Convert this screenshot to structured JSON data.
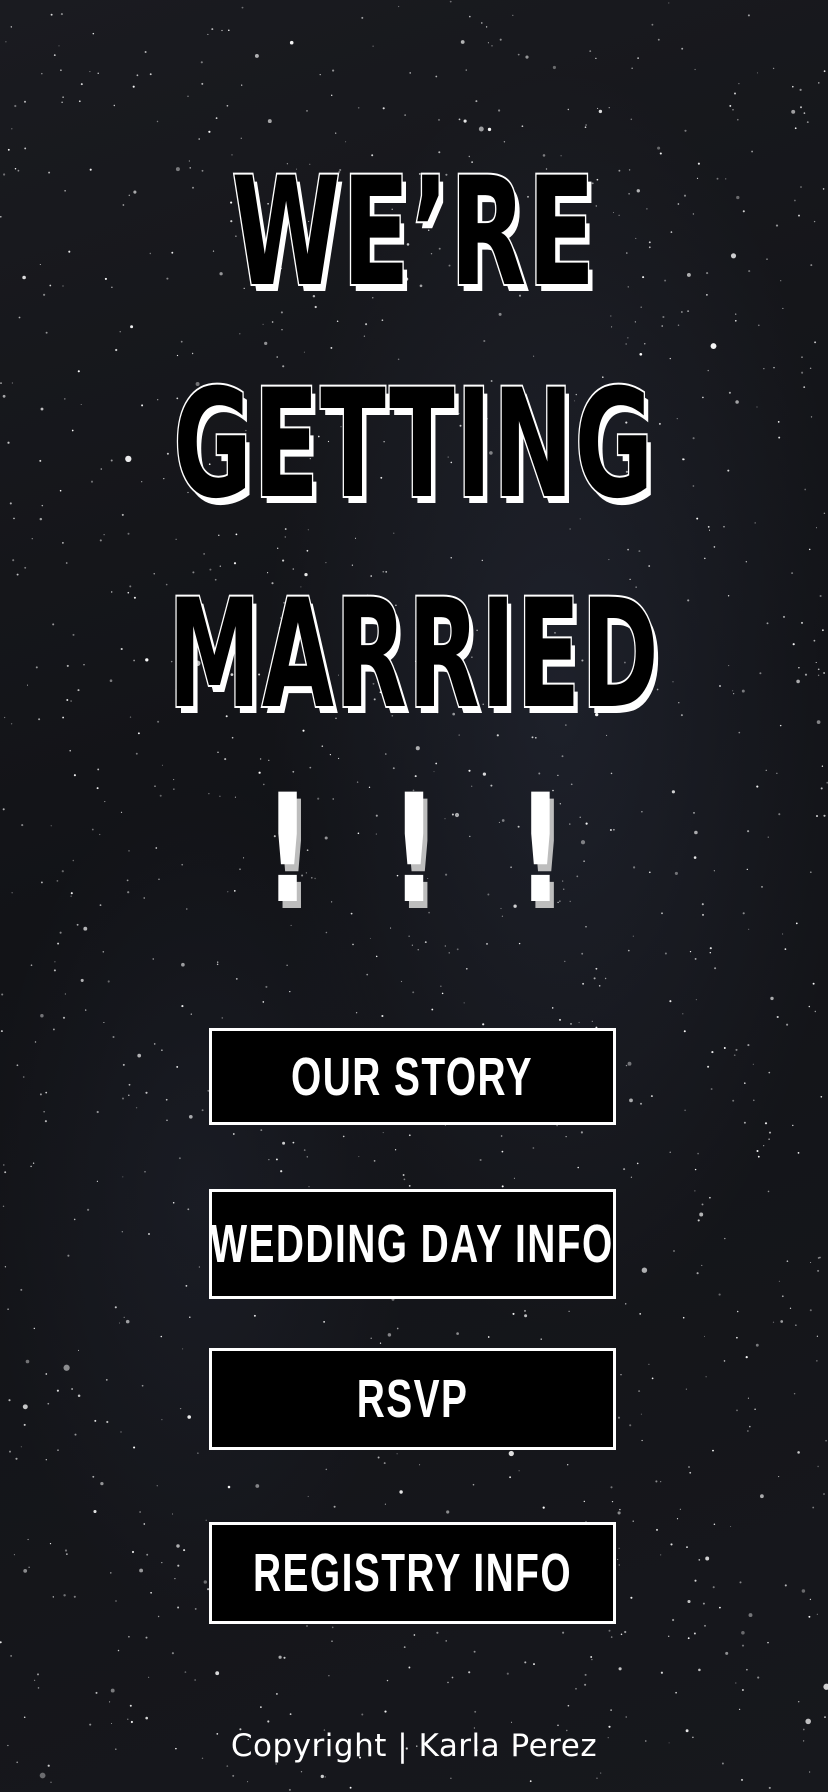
{
  "background": {
    "description_icon": "starry-night-sky",
    "base_color": "#141519"
  },
  "headline": {
    "line_1": "WE’RE",
    "line_2": "GETTING",
    "line_3": "MARRIED",
    "exclamations": "! ! !"
  },
  "menu": {
    "our_story": "OUR STORY",
    "wedding_day_info": "WEDDING DAY INFO",
    "rsvp": "RSVP",
    "registry_info": "REGISTRY INFO"
  },
  "footer": {
    "copyright": "Copyright | Karla Perez"
  },
  "colors": {
    "button_fill": "#000000",
    "button_border": "#ffffff",
    "text": "#ffffff"
  }
}
